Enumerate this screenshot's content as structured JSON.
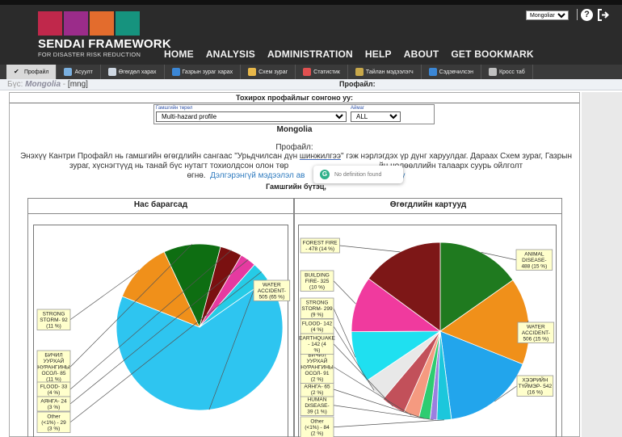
{
  "header": {
    "brand_title": "SENDAI FRAMEWORK",
    "brand_subtitle": "FOR DISASTER RISK REDUCTION",
    "nav": [
      "HOME",
      "ANALYSIS",
      "ADMINISTRATION",
      "HELP",
      "ABOUT",
      "GET BOOKMARK"
    ],
    "language": "Mongolian",
    "help_icon": "question-circle-icon",
    "logout_icon": "logout-arrow-icon",
    "brand_colors": [
      "#c0284b",
      "#9b2c8a",
      "#e36c2d",
      "#16937e"
    ]
  },
  "tabs": [
    {
      "label": "Профайл",
      "icon": "check-icon",
      "color": "#ffffff",
      "active": true
    },
    {
      "label": "Асуулт",
      "icon": "eye-icon",
      "color": "#7ab0e0",
      "active": false
    },
    {
      "label": "Өгөгдөл харах",
      "icon": "table-icon",
      "color": "#cfd8e3",
      "active": false
    },
    {
      "label": "Газрын зураг харах",
      "icon": "globe-icon",
      "color": "#3b87d6",
      "active": false
    },
    {
      "label": "Схем зураг",
      "icon": "chart-icon",
      "color": "#e8b84a",
      "active": false
    },
    {
      "label": "Статистик",
      "icon": "statistics-icon",
      "color": "#e05050",
      "active": false
    },
    {
      "label": "Тайлан мэдээлэгч",
      "icon": "report-icon",
      "color": "#c8a84a",
      "active": false
    },
    {
      "label": "Сэдэвчилсэн",
      "icon": "thematic-globe-icon",
      "color": "#3b87d6",
      "active": false
    },
    {
      "label": "Кросс таб",
      "icon": "grid-icon",
      "color": "#c0c0c0",
      "active": false
    }
  ],
  "breadcrumb": {
    "prefix": "Бүс:",
    "country": "Mongolia",
    "separator": "-",
    "code": "[mng]"
  },
  "profile_heading": "Профайл:",
  "selector": {
    "title": "Тохирох профайлыг сонгоно уу:",
    "disaster_type_label": "Гамшгийн төрөл",
    "disaster_type_value": "Multi-hazard profile",
    "province_label": "Аймаг",
    "province_value": "ALL"
  },
  "country_title": "Mongolia",
  "profile_label": "Профайл:",
  "intro": {
    "part1": "Энэхүү Кантри Профайл нь гамшгийн өгөгдлийн сангаас \"Урьдчилсан дүн ",
    "underlined": "шинжилгээ",
    "part2": "\" гэж нэрлэгдэх үр дүнг харуулдаг. Дараах Схем зураг, Газрын зураг, хүснэгтүүд нь танай бүс нутагт тохиолдсон олон төр",
    "part3": "йн нөлөөллийн талаарх суурь ойлголт",
    "part4": "өгнө.",
    "link": "Дэлгэрэнгүй мэдээлэл ав",
    "tail": "уу"
  },
  "hazard_heading": "Гамшгийн бүтэц, ",
  "tooltip": {
    "icon": "g-circle-icon",
    "text": "No definition found"
  },
  "chart_data": [
    {
      "type": "pie",
      "title": "Нас барагсад",
      "slices": [
        {
          "label": "WATER ACCIDENT- 505 (65 %)",
          "value": 505,
          "color": "#2ec5f0"
        },
        {
          "label": "STRONG STORM- 92 (11 %)",
          "value": 92,
          "color": "#f0901a"
        },
        {
          "label": "БИЧИЛ УУРХАЙ НУРАНГИНЫ ОСОЛ- 85 (11 %)",
          "value": 85,
          "color": "#0e6e12"
        },
        {
          "label": "FLOOD- 33 (4 %)",
          "value": 33,
          "color": "#7a1010"
        },
        {
          "label": "АЯНГА- 24 (3 %)",
          "value": 24,
          "color": "#e63aa0"
        },
        {
          "label": "Other (<1%) - 29 (3 %)",
          "value": 29,
          "color": "#26cbe6"
        }
      ]
    },
    {
      "type": "pie",
      "title": "Өгөгдлийн картууд",
      "slices": [
        {
          "label": "ANIMAL DISEASE- 488 (15 %)",
          "value": 488,
          "color": "#1f7a1f"
        },
        {
          "label": "WATER ACCIDENT- 506 (15 %)",
          "value": 506,
          "color": "#f0901a"
        },
        {
          "label": "ХЭЭРИЙН ТҮЙМЭР- 542 (16 %)",
          "value": 542,
          "color": "#22a5ec"
        },
        {
          "label": "Other (<1%) - 84 (2 %)",
          "value": 84,
          "color": "#1cc7dc"
        },
        {
          "label": "HUMAN DISEASE- 39 (1 %)",
          "value": 39,
          "color": "#9b7fe0"
        },
        {
          "label": "АЯНГА- 65 (2 %)",
          "value": 65,
          "color": "#2ecc71"
        },
        {
          "label": "БИЧИЛ УУРХАЙ НУРАНГИНЫ ОСОЛ- 91 (2 %)",
          "value": 91,
          "color": "#f59a80"
        },
        {
          "label": "EARTHQUAKE - 142 (4 %)",
          "value": 142,
          "color": "#c2505a"
        },
        {
          "label": "FLOOD- 142 (4 %)",
          "value": 142,
          "color": "#e8e8e8"
        },
        {
          "label": "STRONG STORM- 299 (9 %)",
          "value": 299,
          "color": "#1fe0f0"
        },
        {
          "label": "BUILDING FIRE- 325 (10 %)",
          "value": 325,
          "color": "#f03a9e"
        },
        {
          "label": "FOREST FIRE - 478 (14 %)",
          "value": 478,
          "color": "#7d1717"
        }
      ]
    }
  ]
}
